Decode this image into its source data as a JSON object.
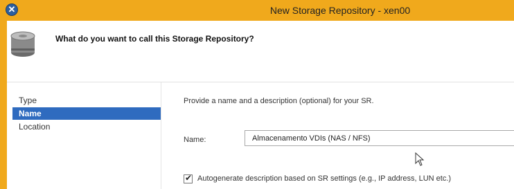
{
  "window": {
    "title": "New Storage Repository - xen00",
    "close_glyph": "✕",
    "accent": "#f0a91c"
  },
  "header": {
    "question": "What do you want to call this Storage Repository?",
    "icon": "storage-disk-icon"
  },
  "sidebar": {
    "items": [
      {
        "label": "Type",
        "active": false
      },
      {
        "label": "Name",
        "active": true
      },
      {
        "label": "Location",
        "active": false
      }
    ],
    "active_color": "#2f6bbf"
  },
  "form": {
    "intro": "Provide a name and a description (optional) for your SR.",
    "name_label": "Name:",
    "name_value": "Almacenamento VDIs (NAS / NFS)",
    "autogenerate_checked": true,
    "autogenerate_label": "Autogenerate description based on SR settings (e.g., IP address, LUN etc.)"
  }
}
